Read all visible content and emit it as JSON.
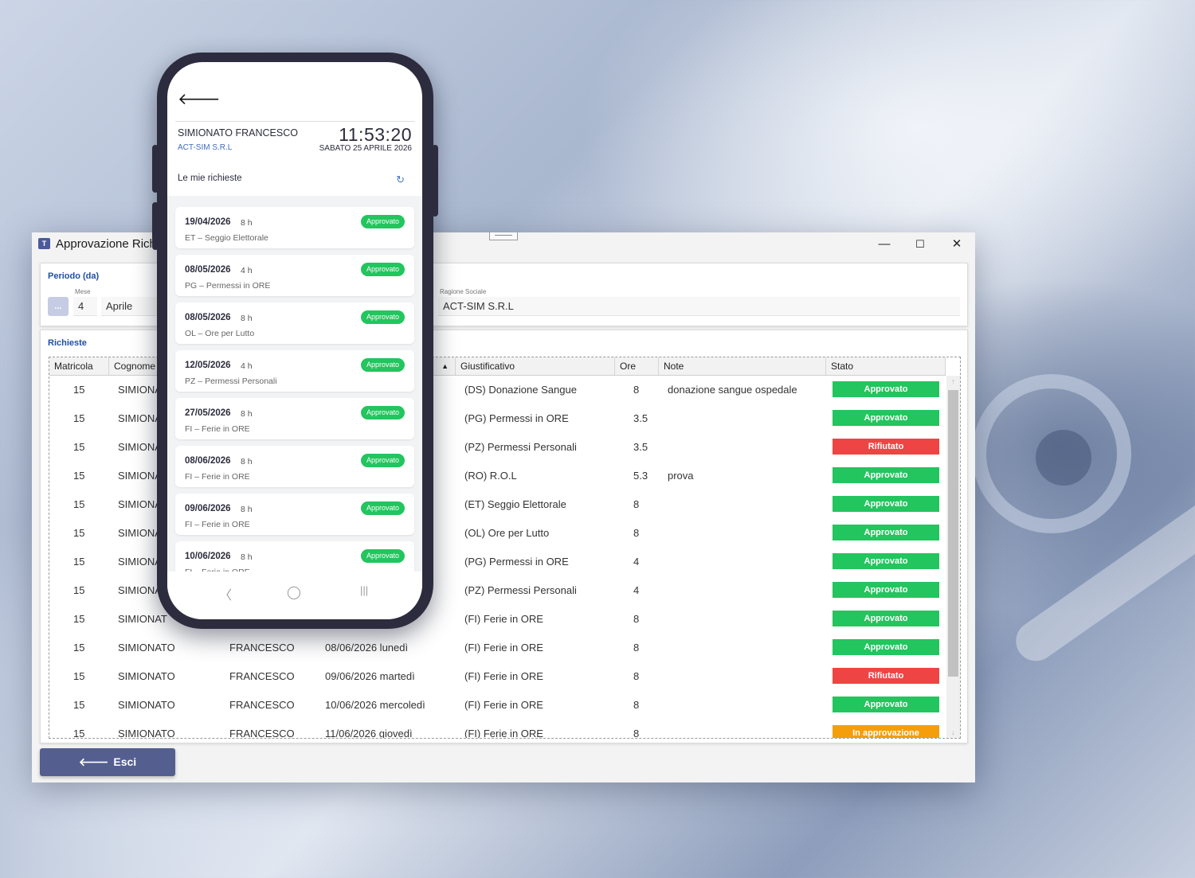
{
  "window": {
    "title": "Approvazione Rich",
    "min": "—",
    "max": "☐",
    "close": "✕"
  },
  "filters": {
    "title": "Periodo (da)",
    "month_label": "Mese",
    "dots": "...",
    "month_num": "4",
    "month_name": "Aprile",
    "company_label": "Ragione Sociale",
    "company": "ACT-SIM S.R.L"
  },
  "requests": {
    "title": "Richieste",
    "headers": {
      "matricola": "Matricola",
      "cognome": "Cognome",
      "giustificativo": "Giustificativo",
      "ore": "Ore",
      "note": "Note",
      "stato": "Stato"
    },
    "rows": [
      {
        "matricola": "15",
        "cognome": "SIMIONA",
        "nome": "",
        "data": "",
        "giust": "(DS) Donazione Sangue",
        "ore": "8",
        "note": "donazione sangue ospedale",
        "stato": "Approvato"
      },
      {
        "matricola": "15",
        "cognome": "SIMIONA",
        "nome": "",
        "data": "",
        "giust": "(PG) Permessi in ORE",
        "ore": "3.5",
        "note": "",
        "stato": "Approvato"
      },
      {
        "matricola": "15",
        "cognome": "SIMIONA",
        "nome": "",
        "data": "",
        "giust": "(PZ) Permessi Personali",
        "ore": "3.5",
        "note": "",
        "stato": "Rifiutato"
      },
      {
        "matricola": "15",
        "cognome": "SIMIONA",
        "nome": "",
        "data": "",
        "giust": "(RO) R.O.L",
        "ore": "5.3",
        "note": "prova",
        "stato": "Approvato"
      },
      {
        "matricola": "15",
        "cognome": "SIMIONA",
        "nome": "",
        "data": "",
        "giust": "(ET) Seggio Elettorale",
        "ore": "8",
        "note": "",
        "stato": "Approvato"
      },
      {
        "matricola": "15",
        "cognome": "SIMIONA",
        "nome": "",
        "data": "",
        "giust": "(OL) Ore per Lutto",
        "ore": "8",
        "note": "",
        "stato": "Approvato"
      },
      {
        "matricola": "15",
        "cognome": "SIMIONA",
        "nome": "",
        "data": "",
        "giust": "(PG) Permessi in ORE",
        "ore": "4",
        "note": "",
        "stato": "Approvato"
      },
      {
        "matricola": "15",
        "cognome": "SIMIONA",
        "nome": "",
        "data": "",
        "giust": "(PZ) Permessi Personali",
        "ore": "4",
        "note": "",
        "stato": "Approvato"
      },
      {
        "matricola": "15",
        "cognome": "SIMIONAT",
        "nome": "",
        "data": "",
        "giust": "(FI) Ferie in ORE",
        "ore": "8",
        "note": "",
        "stato": "Approvato"
      },
      {
        "matricola": "15",
        "cognome": "SIMIONATO",
        "nome": "FRANCESCO",
        "data": "08/06/2026 lunedì",
        "giust": "(FI) Ferie in ORE",
        "ore": "8",
        "note": "",
        "stato": "Approvato"
      },
      {
        "matricola": "15",
        "cognome": "SIMIONATO",
        "nome": "FRANCESCO",
        "data": "09/06/2026 martedì",
        "giust": "(FI) Ferie in ORE",
        "ore": "8",
        "note": "",
        "stato": "Rifiutato"
      },
      {
        "matricola": "15",
        "cognome": "SIMIONATO",
        "nome": "FRANCESCO",
        "data": "10/06/2026 mercoledì",
        "giust": "(FI) Ferie in ORE",
        "ore": "8",
        "note": "",
        "stato": "Approvato"
      },
      {
        "matricola": "15",
        "cognome": "SIMIONATO",
        "nome": "FRANCESCO",
        "data": "11/06/2026 giovedì",
        "giust": "(FI) Ferie in ORE",
        "ore": "8",
        "note": "",
        "stato": "In approvazione"
      }
    ]
  },
  "exit_button": {
    "arrow": "🡐",
    "label": "Esci"
  },
  "status_colors": {
    "Approvato": "#22c55e",
    "Rifiutato": "#ef4444",
    "In approvazione": "#f59e0b"
  },
  "phone": {
    "back": "🡐",
    "name": "SIMIONATO FRANCESCO",
    "company": "ACT-SIM S.R.L",
    "time": "11:53:20",
    "date": "SABATO 25 APRILE 2026",
    "section": "Le mie richieste",
    "refresh": "↻",
    "items": [
      {
        "date": "19/04/2026",
        "hours": "8 h",
        "desc": "ET – Seggio Elettorale",
        "status": "Approvato"
      },
      {
        "date": "08/05/2026",
        "hours": "4 h",
        "desc": "PG – Permessi in ORE",
        "status": "Approvato"
      },
      {
        "date": "08/05/2026",
        "hours": "8 h",
        "desc": "OL – Ore per Lutto",
        "status": "Approvato"
      },
      {
        "date": "12/05/2026",
        "hours": "4 h",
        "desc": "PZ – Permessi Personali",
        "status": "Approvato"
      },
      {
        "date": "27/05/2026",
        "hours": "8 h",
        "desc": "FI – Ferie in ORE",
        "status": "Approvato"
      },
      {
        "date": "08/06/2026",
        "hours": "8 h",
        "desc": "FI – Ferie in ORE",
        "status": "Approvato"
      },
      {
        "date": "09/06/2026",
        "hours": "8 h",
        "desc": "FI – Ferie in ORE",
        "status": "Approvato"
      },
      {
        "date": "10/06/2026",
        "hours": "8 h",
        "desc": "FI – Ferie in ORE",
        "status": "Approvato"
      }
    ],
    "nav": {
      "back": "〈",
      "home": "◯",
      "recents": "|||"
    }
  }
}
